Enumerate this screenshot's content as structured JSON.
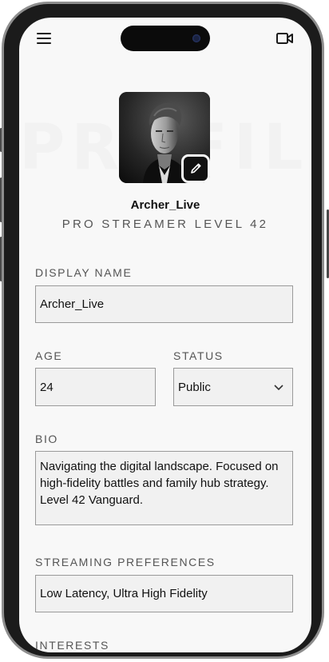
{
  "profile": {
    "username": "Archer_Live",
    "level_text": "PRO STREAMER LEVEL 42",
    "watermark": "PROFILE"
  },
  "form": {
    "display_name_label": "DISPLAY NAME",
    "display_name_value": "Archer_Live",
    "age_label": "AGE",
    "age_value": "24",
    "status_label": "STATUS",
    "status_value": "Public",
    "bio_label": "BIO",
    "bio_value": "Navigating the digital landscape. Focused on high-fidelity battles and family hub strategy. Level 42 Vanguard.",
    "streaming_label": "STREAMING PREFERENCES",
    "streaming_value": "Low Latency, Ultra High Fidelity",
    "interests_label": "INTERESTS"
  },
  "icons": {
    "menu": "menu-icon",
    "video": "video-camera-icon",
    "edit": "pencil-icon",
    "status_dropdown": "chevron-down-icon"
  },
  "colors": {
    "screen_bg": "#f8f8f8",
    "field_bg": "#f1f1f1",
    "field_border": "#9a9a9a",
    "label": "#555555",
    "text": "#111111",
    "accent_dark": "#111111"
  }
}
